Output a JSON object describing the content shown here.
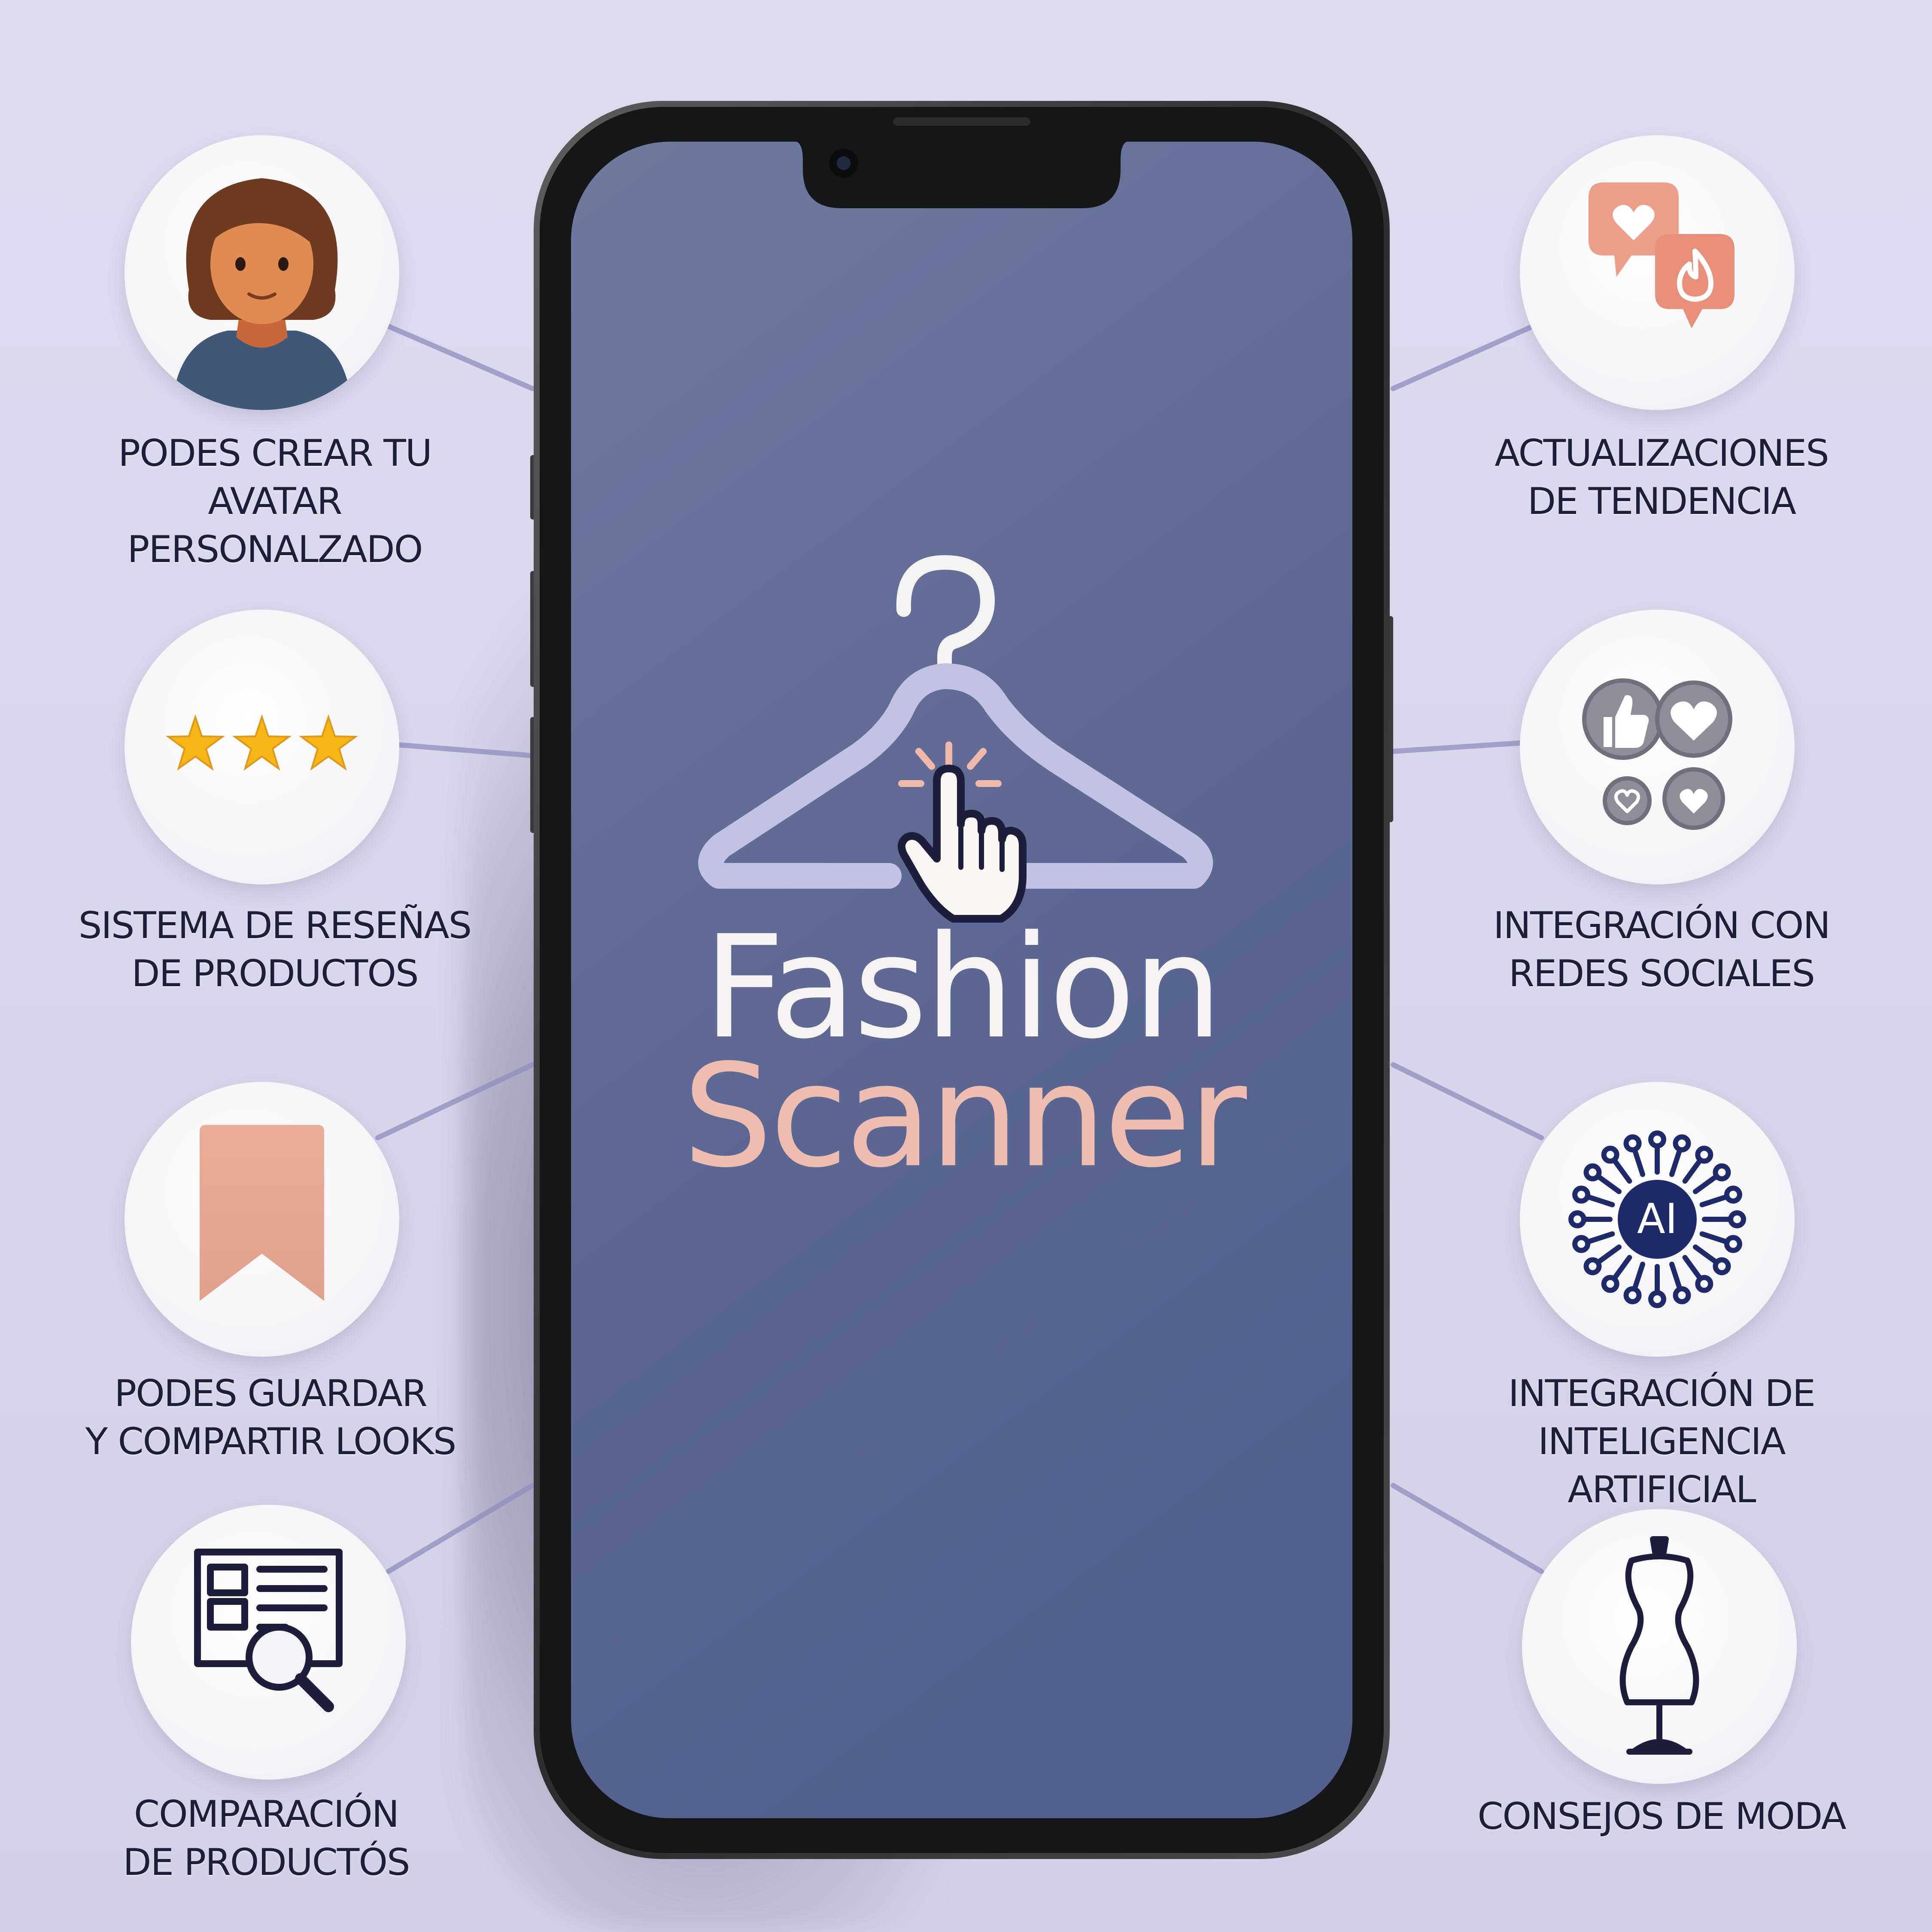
{
  "brand": {
    "line1": "Fashion",
    "line2": "Scanner",
    "colors": {
      "fashion_text": "#f7f3f2",
      "scanner_text": "#efbcb0",
      "screen": "#5e6b97",
      "hanger": "#c1c2e4"
    }
  },
  "features": [
    {
      "icon": "avatar-icon",
      "line1": "PODES CREAR TU",
      "line2": "AVATAR PERSONALZADO"
    },
    {
      "icon": "star-rating-icon",
      "line1": "SISTEMA DE RESEÑAS",
      "line2": "DE PRODUCTOS"
    },
    {
      "icon": "bookmark-icon",
      "line1": "PODES GUARDAR",
      "line2": "Y COMPARTIR LOOKS"
    },
    {
      "icon": "product-compare-icon",
      "line1": "COMPARACIÓN",
      "line2": "DE PRODUCTÓS"
    },
    {
      "icon": "trend-bubbles-icon",
      "line1": "ACTUALIZACIONES",
      "line2": "DE TENDENCIA"
    },
    {
      "icon": "social-reactions-icon",
      "line1": "INTEGRACIÓN CON",
      "line2": "REDES SOCIALES"
    },
    {
      "icon": "ai-chip-icon",
      "icon_text": "AI",
      "line1": "INTEGRACIÓN DE",
      "line2": "INTELIGENCIA ARTIFICIAL"
    },
    {
      "icon": "dress-form-icon",
      "line1": "CONSEJOS DE MODA",
      "line2": ""
    }
  ]
}
